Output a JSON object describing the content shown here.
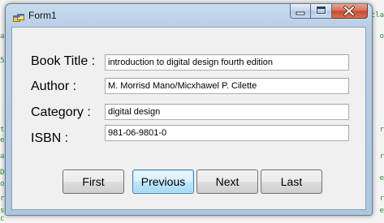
{
  "background": {
    "left_gutter_chars": [
      "1",
      "a",
      "5",
      "5",
      "t",
      "e",
      "a",
      "D",
      "o",
      "r",
      "s",
      "c"
    ],
    "right_gutter_chars": [
      "cla",
      "o",
      "r",
      "r",
      "e",
      "r",
      "e"
    ]
  },
  "window": {
    "title": "Form1",
    "icon": "form-app-icon",
    "caption_icons": [
      "minimize-icon",
      "maximize-icon",
      "close-icon"
    ]
  },
  "form": {
    "fields": [
      {
        "label": "Book Title :",
        "value": "introduction to digital design fourth edition"
      },
      {
        "label": "Author :",
        "value": "M. Morrisd Mano/Micxhawel P. Cilette"
      },
      {
        "label": "Category :",
        "value": "digital design"
      },
      {
        "label": "ISBN :",
        "value": "981-06-9801-0"
      }
    ],
    "buttons": {
      "first": "First",
      "previous": "Previous",
      "next": "Next",
      "last": "Last"
    }
  },
  "colors": {
    "frame": "#b9cfe6",
    "client": "#f0f0f0",
    "close_button": "#c34a2e",
    "focused_button": "#3c7fb1"
  }
}
